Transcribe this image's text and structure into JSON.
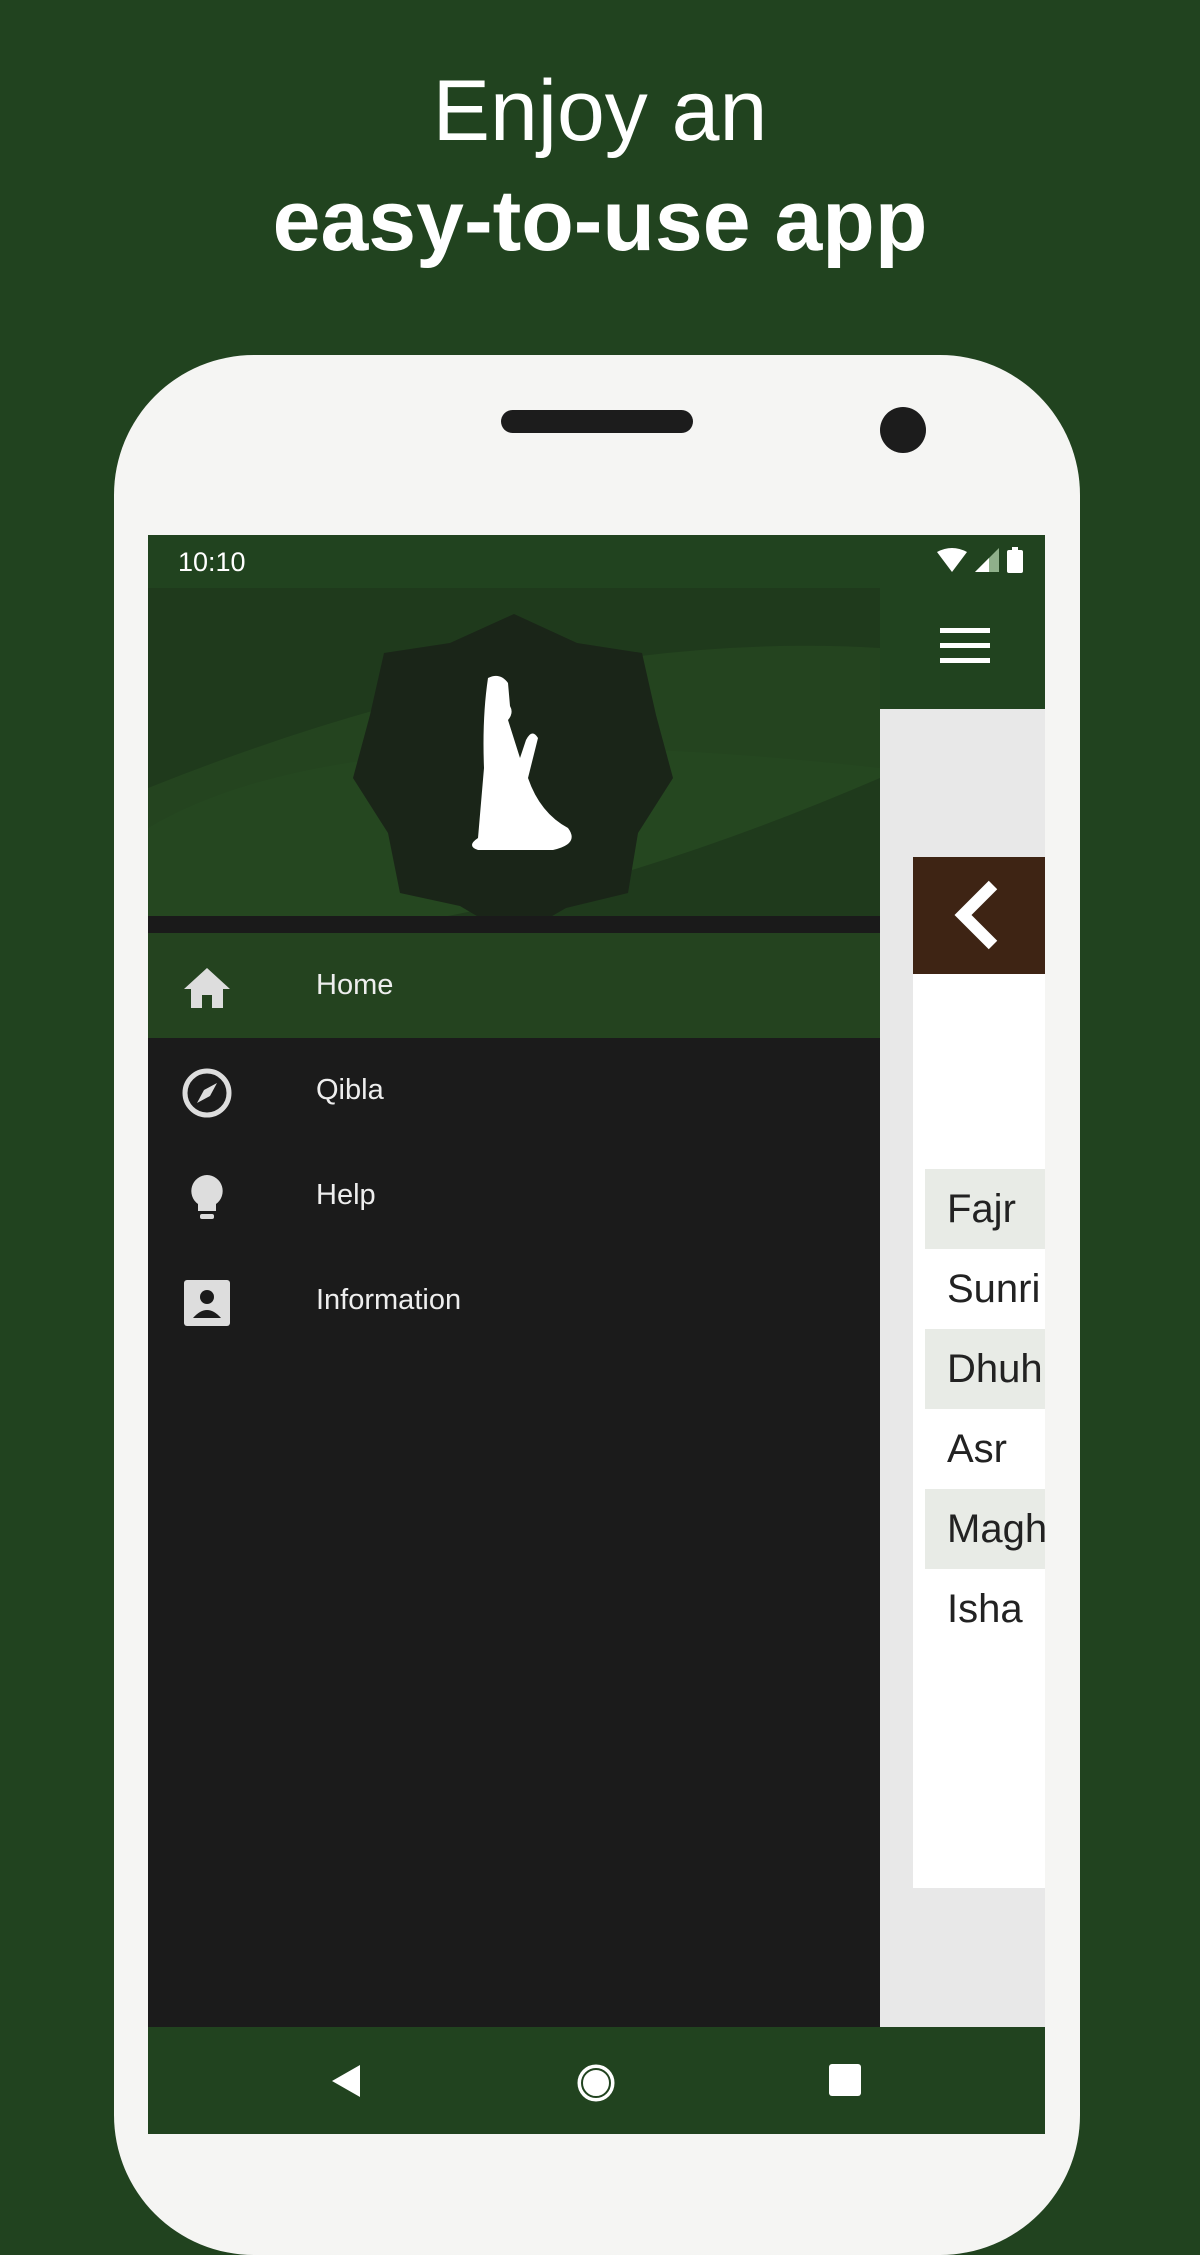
{
  "headline": {
    "line1": "Enjoy an",
    "line2": "easy-to-use app"
  },
  "status_bar": {
    "time": "10:10",
    "icons": [
      "wifi-icon",
      "signal-icon",
      "battery-icon"
    ]
  },
  "drawer": {
    "items": [
      {
        "label": "Home",
        "icon": "home-icon",
        "active": true
      },
      {
        "label": "Qibla",
        "icon": "compass-icon",
        "active": false
      },
      {
        "label": "Help",
        "icon": "lightbulb-icon",
        "active": false
      },
      {
        "label": "Information",
        "icon": "contact-card-icon",
        "active": false
      }
    ]
  },
  "prayers": [
    "Fajr",
    "Sunri",
    "Dhuh",
    "Asr",
    "Magh",
    "Isha"
  ],
  "nav_bar": [
    "back-icon",
    "home-circle-icon",
    "recents-icon"
  ],
  "colors": {
    "background": "#21431f",
    "drawer": "#1b1b1b",
    "active": "#24431f",
    "back_button": "#3e2414"
  }
}
